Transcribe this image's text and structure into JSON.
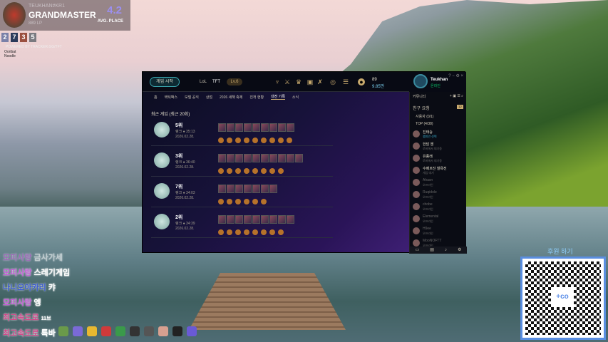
{
  "overlay": {
    "summoner": "TEUKHAN#KR1",
    "tier": "GRANDMASTER",
    "lp": "889 LP",
    "avg_place": "4.2",
    "avg_label": "AVG. PLACE",
    "recent_places": [
      "2",
      "7",
      "3",
      "5"
    ],
    "tracker": "POWERED BY TRACKER.GG/TFT",
    "mini_text": [
      "Ooribat",
      "Noodle"
    ]
  },
  "chat": [
    {
      "user": "모피사랑",
      "msg": "금사가세"
    },
    {
      "user": "모피사랑",
      "msg": "스레기게임"
    },
    {
      "user": "나니오아카리",
      "msg": "캬"
    },
    {
      "user": "모피사랑",
      "msg": "엥"
    },
    {
      "user": "최고속도로",
      "msg": "11브"
    },
    {
      "user": "최고속도로",
      "msg": "특바"
    }
  ],
  "client": {
    "play_button": "게임 시작",
    "lol_tab": "LoL",
    "tft_tab": "TFT",
    "level": "Lv.6",
    "currency": {
      "rp": "89",
      "be": "9.85만"
    },
    "user": {
      "name": "Teukhan",
      "status": "온라인"
    },
    "nav": [
      "홈",
      "택틱팩스",
      "모델 공석",
      "상점",
      "2026 새해 축제",
      "진척 현황",
      "대전 기록",
      "소식"
    ],
    "active_nav": "대전 기록",
    "section_title": "최근 게임 (최근 20회)",
    "matches": [
      {
        "place": "5위",
        "mode": "랭크 ● 35:13",
        "date": "2026.02.28.",
        "units": 9,
        "traits": 9
      },
      {
        "place": "3위",
        "mode": "랭크 ● 36:40",
        "date": "2026.02.28.",
        "units": 10,
        "traits": 8
      },
      {
        "place": "7위",
        "mode": "랭크 ● 34:03",
        "date": "2026.02.28.",
        "units": 7,
        "traits": 6
      },
      {
        "place": "2위",
        "mode": "랭크 ● 34:39",
        "date": "2026.02.28.",
        "units": 9,
        "traits": 8
      }
    ],
    "sidebar": {
      "header": "커뮤니티",
      "friend_requests": "친구 요청",
      "request_count": "12",
      "groups": [
        "사용자 (0/1)",
        "TOP (4/38)"
      ],
      "friends": [
        {
          "name": "진태승",
          "status": "챔피언 선택",
          "online": true
        },
        {
          "name": "한담 젠",
          "status": "로비에서 대기중",
          "online": true
        },
        {
          "name": "유종래",
          "status": "로비에서 대기중",
          "online": true
        },
        {
          "name": "수페르진 철욕전",
          "status": "게임 대기",
          "online": true
        },
        {
          "name": "Ahasn",
          "status": "오프라인",
          "online": false
        },
        {
          "name": "Ruqidole",
          "status": "오프라인",
          "online": false
        },
        {
          "name": "chobe",
          "status": "오프라인",
          "online": false
        },
        {
          "name": "Elemental",
          "status": "오프라인",
          "online": false
        },
        {
          "name": "H9ee",
          "status": "오프라인",
          "online": false
        },
        {
          "name": "MooNOFTT",
          "status": "오프라인",
          "online": false
        }
      ]
    }
  },
  "donation": {
    "title": "후원 하기",
    "logo": "+co"
  }
}
